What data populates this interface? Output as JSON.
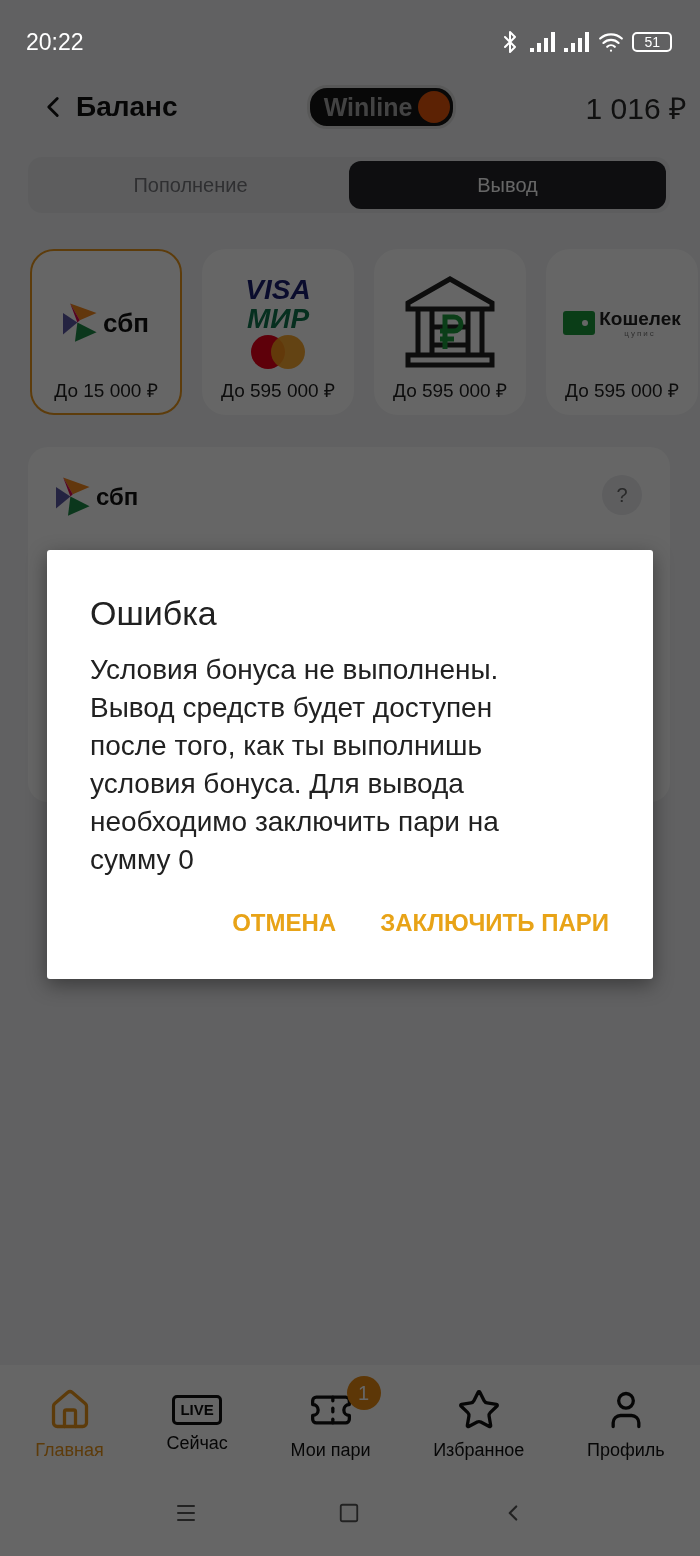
{
  "status_bar": {
    "time": "20:22",
    "battery": "51"
  },
  "header": {
    "title": "Баланс",
    "brand": "Winline",
    "balance": "1 016 ₽"
  },
  "tabs": [
    {
      "label": "Пополнение",
      "selected": false
    },
    {
      "label": "Вывод",
      "selected": true
    }
  ],
  "methods": [
    {
      "kind": "sbp",
      "logo_text": "сбп",
      "limit": "До 15 000 ₽",
      "selected": true
    },
    {
      "kind": "cards",
      "logo_texts": [
        "VISA",
        "МИР"
      ],
      "limit": "До 595 000 ₽",
      "selected": false
    },
    {
      "kind": "bank",
      "limit": "До 595 000 ₽",
      "selected": false
    },
    {
      "kind": "wallet",
      "logo_text": "Кошелек",
      "logo_subtext": "цупис",
      "limit": "До 595 000 ₽",
      "selected": false
    }
  ],
  "card": {
    "logo_text": "сбп",
    "help": "?"
  },
  "dialog": {
    "title": "Ошибка",
    "message": "Условия бонуса не выполнены. Вывод средств будет доступен после того, как ты выполнишь условия бонуса. Для вывода необходимо заключить пари на сумму 0",
    "buttons": [
      "ОТМЕНА",
      "ЗАКЛЮЧИТЬ ПАРИ"
    ]
  },
  "nav": [
    {
      "kind": "home",
      "label": "Главная",
      "selected": true
    },
    {
      "kind": "live",
      "icon_text": "LIVE",
      "label": "Сейчас",
      "selected": false
    },
    {
      "kind": "ticket",
      "label": "Мои пари",
      "badge": "1",
      "selected": false
    },
    {
      "kind": "star",
      "label": "Избранное",
      "selected": false
    },
    {
      "kind": "profile",
      "label": "Профиль",
      "selected": false
    }
  ]
}
